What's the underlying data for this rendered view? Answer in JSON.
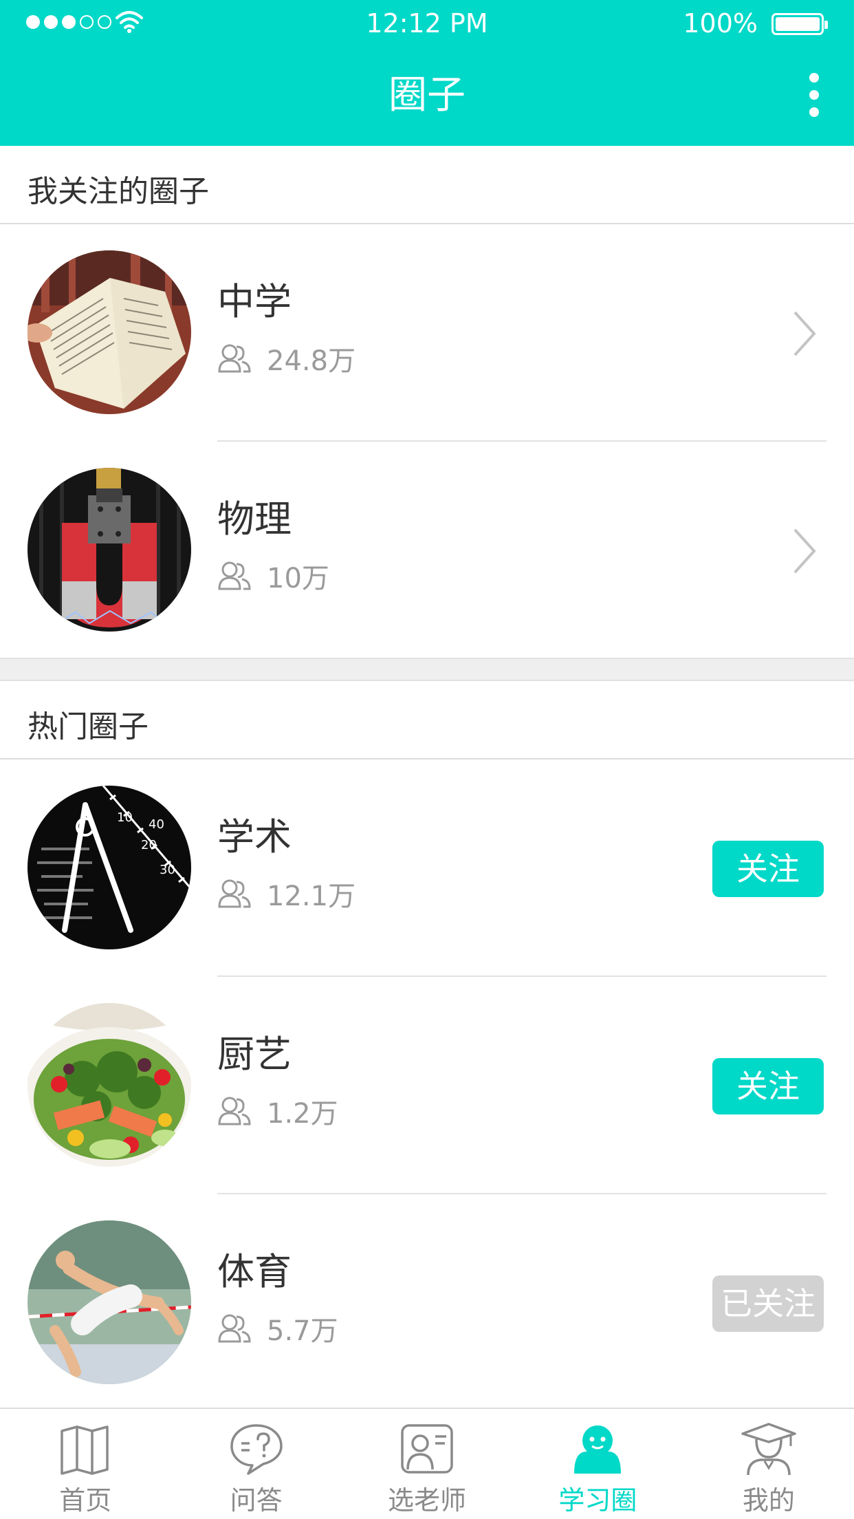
{
  "status_bar": {
    "time": "12:12 PM",
    "battery": "100%"
  },
  "nav": {
    "title": "圈子",
    "more_icon": "more-vertical-icon"
  },
  "my_circles": {
    "header": "我关注的圈子",
    "items": [
      {
        "name": "中学",
        "members": "24.8万",
        "thumb": "book-photo"
      },
      {
        "name": "物理",
        "members": "10万",
        "thumb": "magnet-photo"
      }
    ]
  },
  "hot_circles": {
    "header": "热门圈子",
    "items": [
      {
        "name": "学术",
        "members": "12.1万",
        "button": "关注",
        "followed": false,
        "thumb": "compass-photo"
      },
      {
        "name": "厨艺",
        "members": "1.2万",
        "button": "关注",
        "followed": false,
        "thumb": "salad-photo"
      },
      {
        "name": "体育",
        "members": "5.7万",
        "button": "已关注",
        "followed": true,
        "thumb": "high-jump-photo"
      }
    ]
  },
  "tabbar": {
    "active_index": 3,
    "tabs": [
      {
        "label": "首页",
        "icon": "book-icon"
      },
      {
        "label": "问答",
        "icon": "question-bubble-icon"
      },
      {
        "label": "选老师",
        "icon": "teacher-card-icon"
      },
      {
        "label": "学习圈",
        "icon": "study-circle-icon"
      },
      {
        "label": "我的",
        "icon": "graduate-icon"
      }
    ]
  },
  "colors": {
    "accent": "#00d8c8",
    "followed_button": "#d2d2d2",
    "text_primary": "#333333",
    "text_secondary": "#9a9a9a",
    "divider": "#e2e2e2"
  }
}
